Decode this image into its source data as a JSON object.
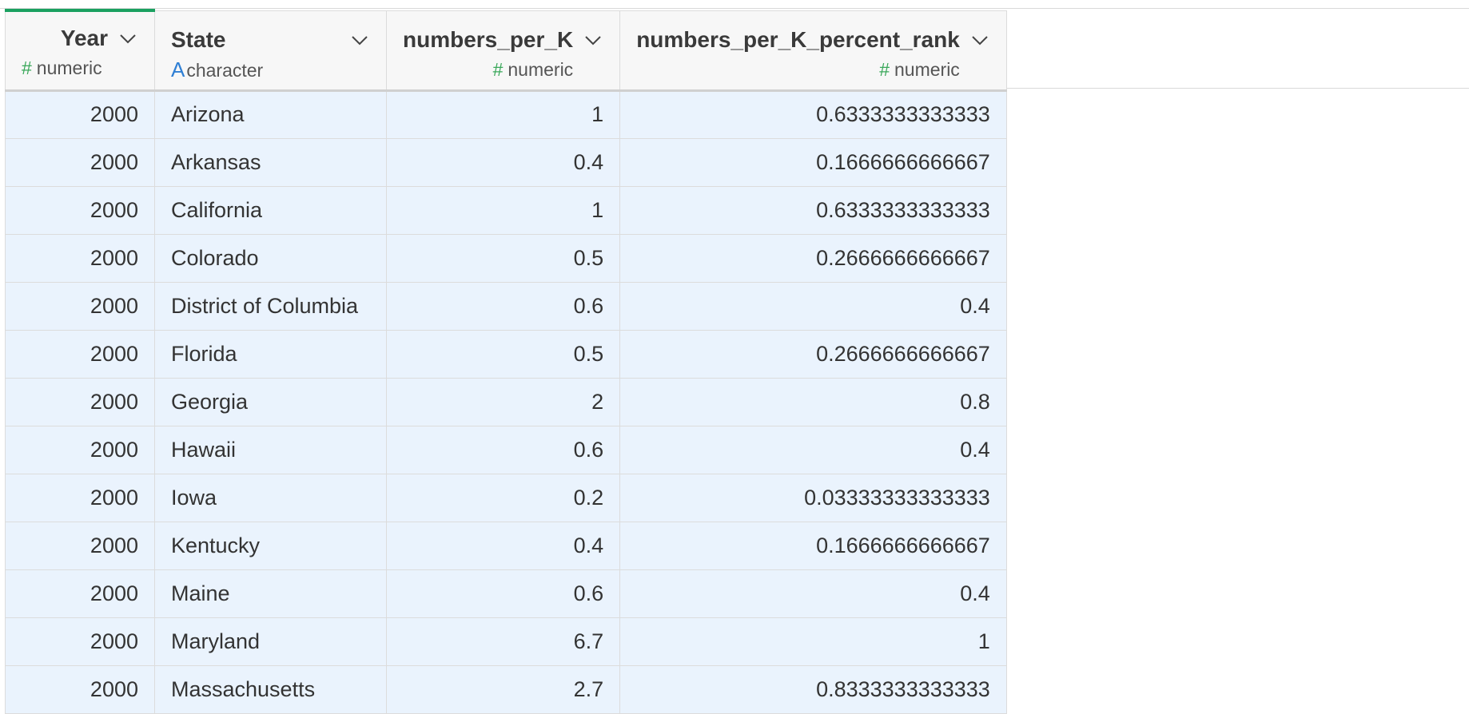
{
  "columns": [
    {
      "name": "Year",
      "type_icon": "#",
      "type": "numeric"
    },
    {
      "name": "State",
      "type_icon": "A",
      "type": "character"
    },
    {
      "name": "numbers_per_K",
      "type_icon": "#",
      "type": "numeric"
    },
    {
      "name": "numbers_per_K_percent_rank",
      "type_icon": "#",
      "type": "numeric"
    }
  ],
  "rows": [
    {
      "year": "2000",
      "state": "Arizona",
      "numbers_per_k": "1",
      "percent_rank": "0.6333333333333"
    },
    {
      "year": "2000",
      "state": "Arkansas",
      "numbers_per_k": "0.4",
      "percent_rank": "0.1666666666667"
    },
    {
      "year": "2000",
      "state": "California",
      "numbers_per_k": "1",
      "percent_rank": "0.6333333333333"
    },
    {
      "year": "2000",
      "state": "Colorado",
      "numbers_per_k": "0.5",
      "percent_rank": "0.2666666666667"
    },
    {
      "year": "2000",
      "state": "District of Columbia",
      "numbers_per_k": "0.6",
      "percent_rank": "0.4"
    },
    {
      "year": "2000",
      "state": "Florida",
      "numbers_per_k": "0.5",
      "percent_rank": "0.2666666666667"
    },
    {
      "year": "2000",
      "state": "Georgia",
      "numbers_per_k": "2",
      "percent_rank": "0.8"
    },
    {
      "year": "2000",
      "state": "Hawaii",
      "numbers_per_k": "0.6",
      "percent_rank": "0.4"
    },
    {
      "year": "2000",
      "state": "Iowa",
      "numbers_per_k": "0.2",
      "percent_rank": "0.03333333333333"
    },
    {
      "year": "2000",
      "state": "Kentucky",
      "numbers_per_k": "0.4",
      "percent_rank": "0.1666666666667"
    },
    {
      "year": "2000",
      "state": "Maine",
      "numbers_per_k": "0.6",
      "percent_rank": "0.4"
    },
    {
      "year": "2000",
      "state": "Maryland",
      "numbers_per_k": "6.7",
      "percent_rank": "1"
    },
    {
      "year": "2000",
      "state": "Massachusetts",
      "numbers_per_k": "2.7",
      "percent_rank": "0.8333333333333"
    }
  ],
  "colors": {
    "active_column_accent": "#1aa060",
    "numeric_type_icon": "#3aa85a",
    "character_type_icon": "#2f7fd4",
    "row_background": "#eaf3fd",
    "header_background": "#f7f7f7"
  },
  "icons": {
    "column_menu": "chevron-down-icon",
    "numeric_type": "hash-icon",
    "character_type": "letter-a-icon"
  }
}
